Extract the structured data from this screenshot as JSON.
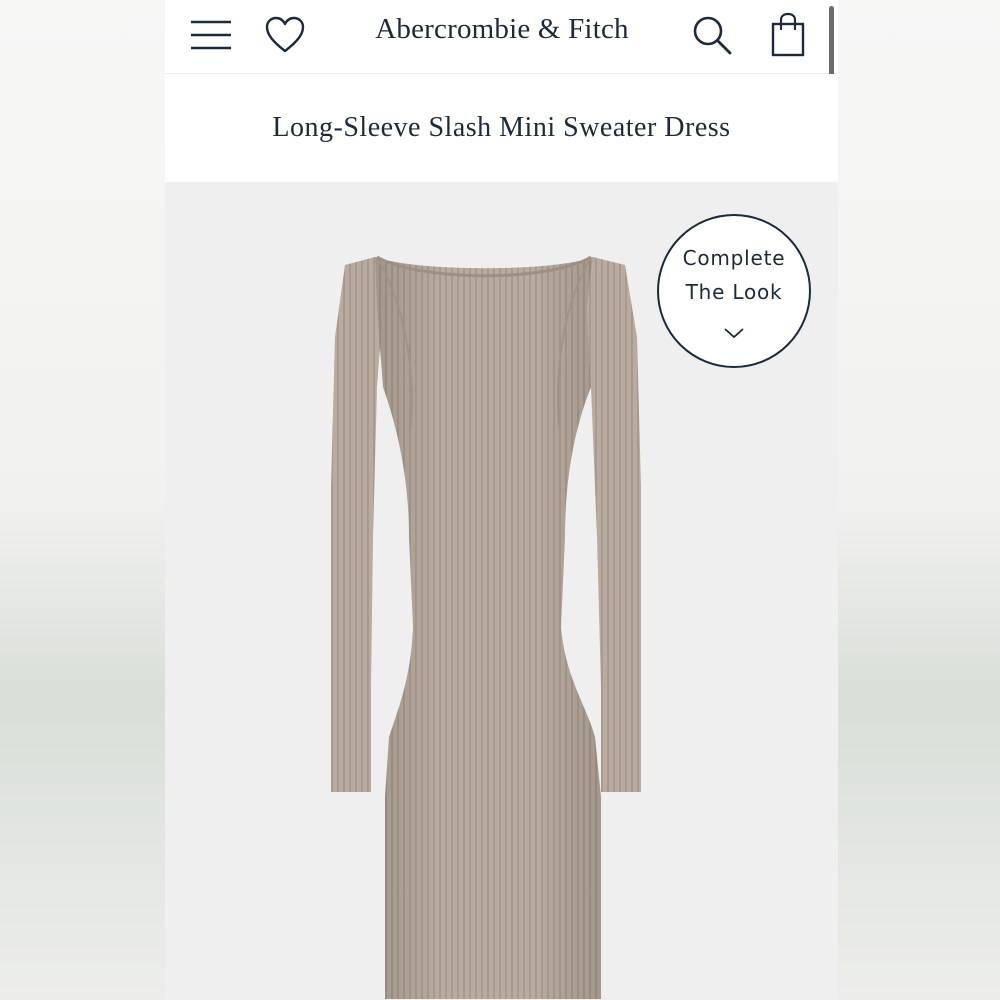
{
  "header": {
    "brand": "Abercrombie & Fitch",
    "icons": {
      "menu": "hamburger-menu-icon",
      "favorites": "heart-icon",
      "search": "search-icon",
      "bag": "shopping-bag-icon"
    }
  },
  "product": {
    "title": "Long-Sleeve Slash Mini Sweater Dress",
    "image_color": "#b8aa9f"
  },
  "complete_the_look": {
    "line1": "Complete",
    "line2": "The Look",
    "icon": "chevron-down-icon"
  },
  "colors": {
    "brand_navy": "#1d2a3a",
    "header_bg": "#ffffff",
    "product_bg": "#efefef"
  }
}
